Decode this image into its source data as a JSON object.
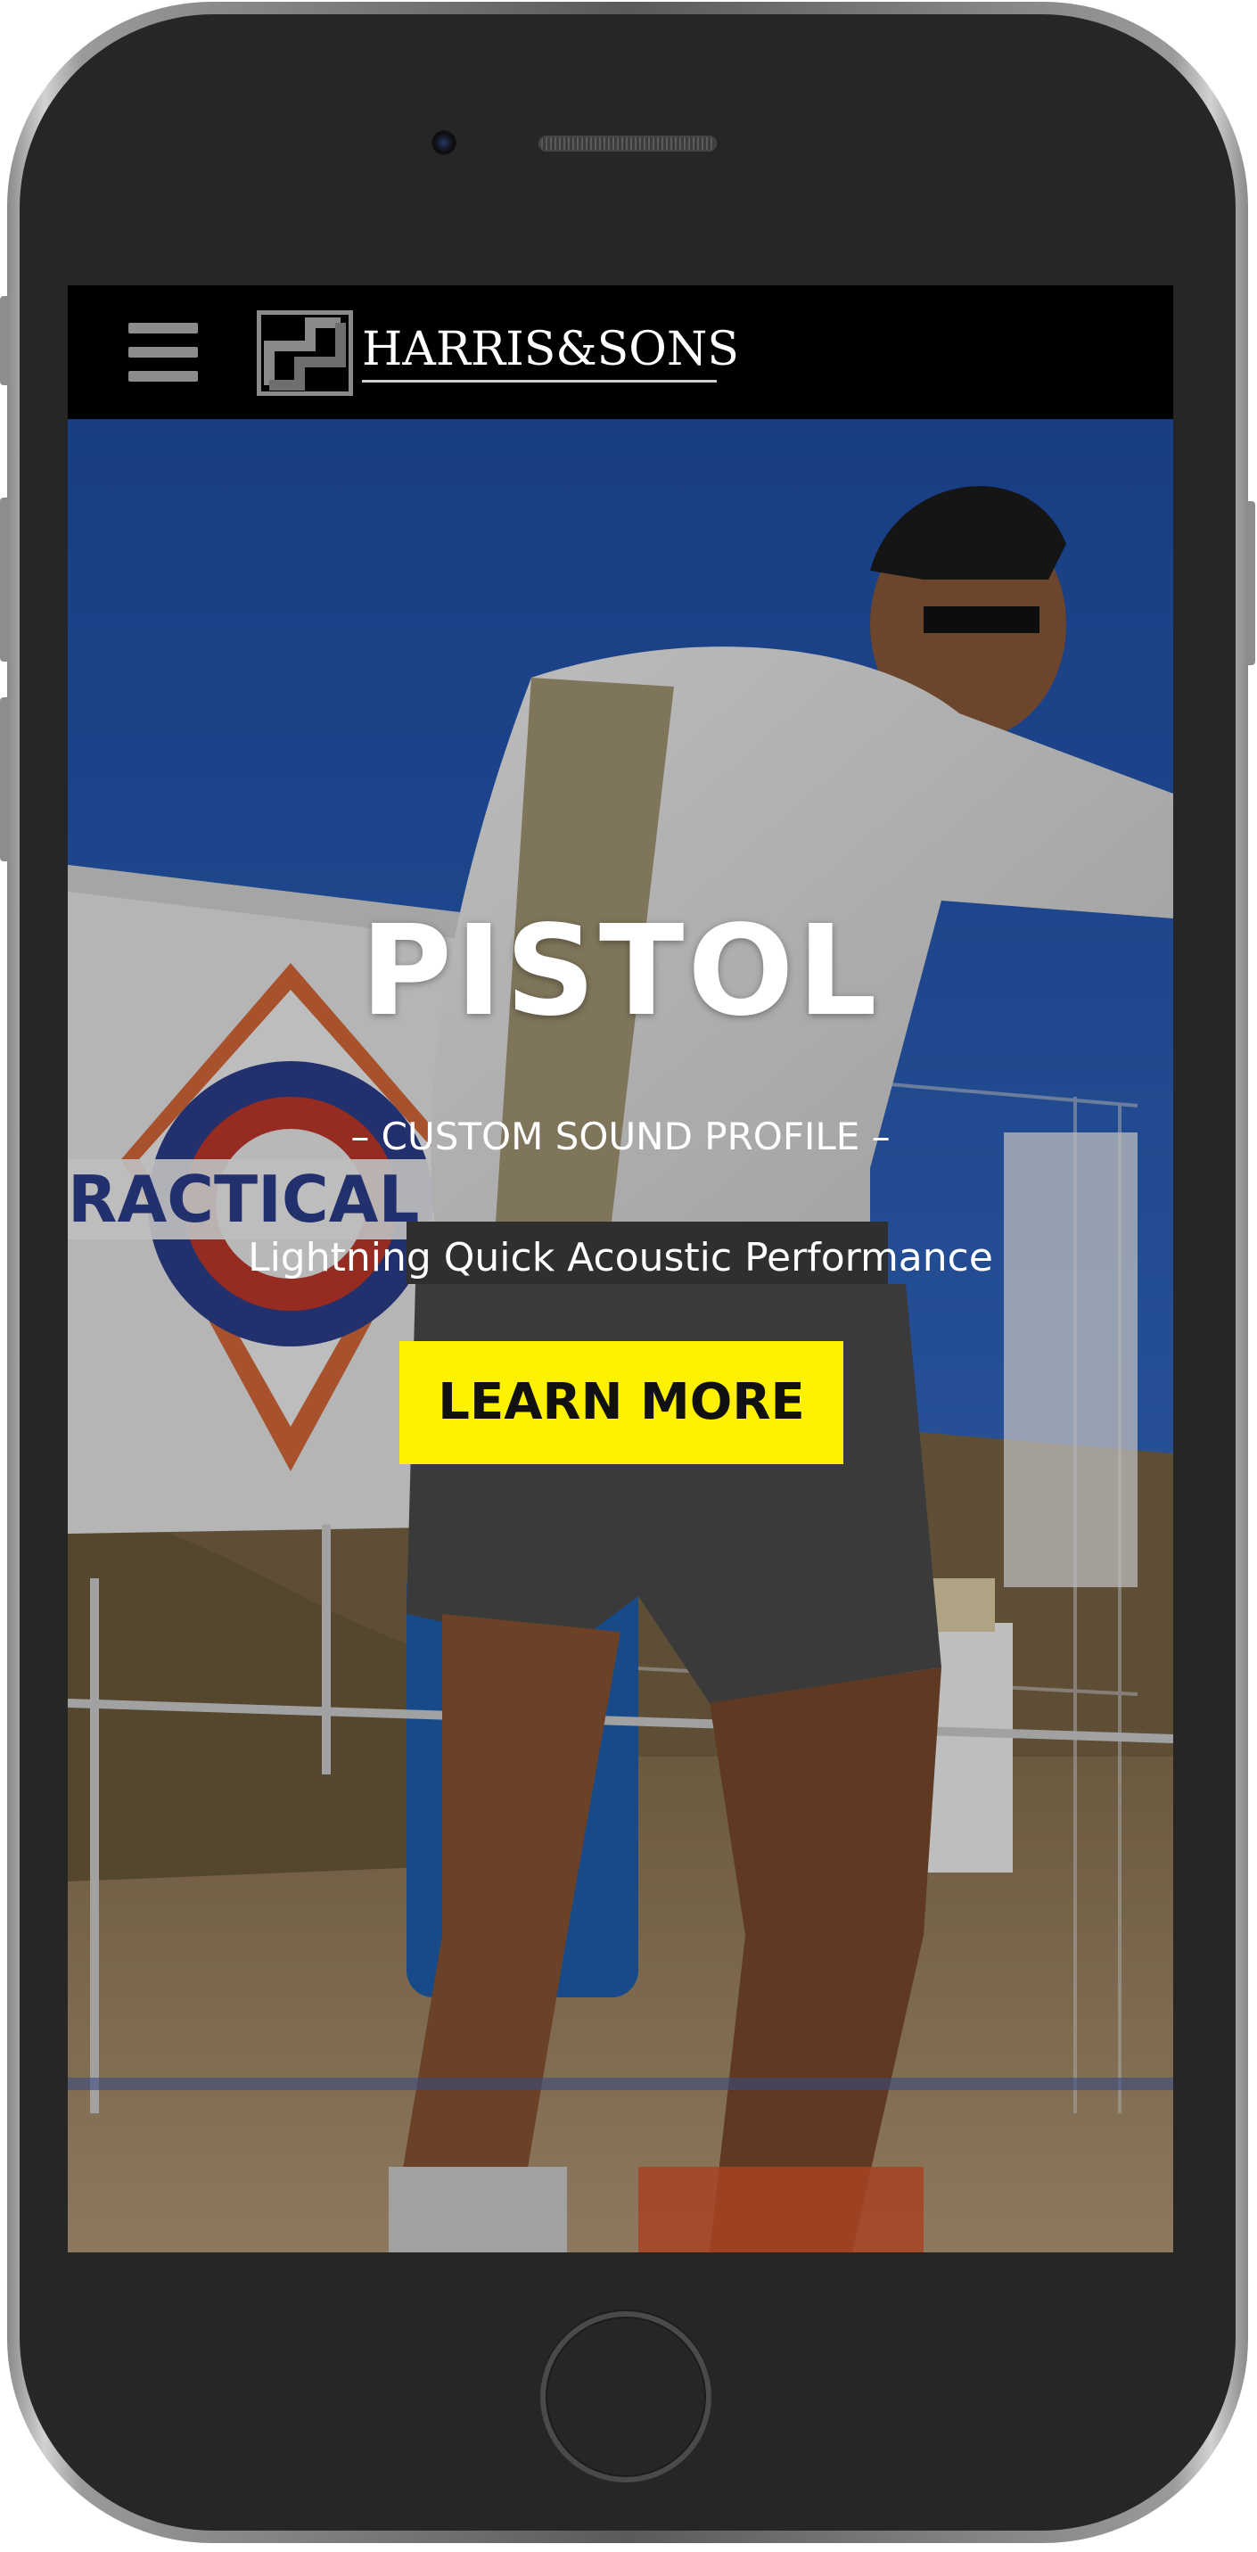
{
  "header": {
    "menu_icon": "hamburger-menu-icon",
    "brand": "HARRIS&SONS",
    "logo_mark": "hs-monogram-logo"
  },
  "hero": {
    "title": "PISTOL",
    "subtitle": "– CUSTOM SOUND PROFILE –",
    "tagline": "Lightning Quick Acoustic Performance",
    "cta_label": "LEARN MORE"
  },
  "colors": {
    "navbar": "#000000",
    "cta_background": "#fff200",
    "cta_text": "#111111",
    "hero_text": "#ffffff",
    "device_body": "#262626"
  },
  "device": {
    "camera_icon": "front-camera-icon",
    "speaker_icon": "earpiece-speaker-icon",
    "home_icon": "home-button-icon"
  }
}
